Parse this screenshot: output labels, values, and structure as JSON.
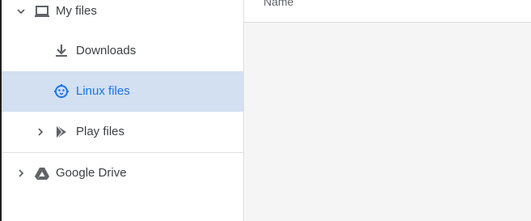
{
  "main": {
    "column_header": "Name"
  },
  "sidebar": {
    "items": [
      {
        "label": "My files",
        "icon": "laptop-icon",
        "expanded": true
      },
      {
        "label": "Downloads",
        "icon": "download-icon"
      },
      {
        "label": "Linux files",
        "icon": "penguin-icon",
        "selected": true
      },
      {
        "label": "Play files",
        "icon": "play-store-icon",
        "expanded": false
      },
      {
        "label": "Google Drive",
        "icon": "drive-icon",
        "expanded": false
      }
    ]
  },
  "colors": {
    "selected_bg": "#d2e0f2",
    "accent": "#1a73e8",
    "text": "#3c4043",
    "icon": "#5f6368"
  }
}
